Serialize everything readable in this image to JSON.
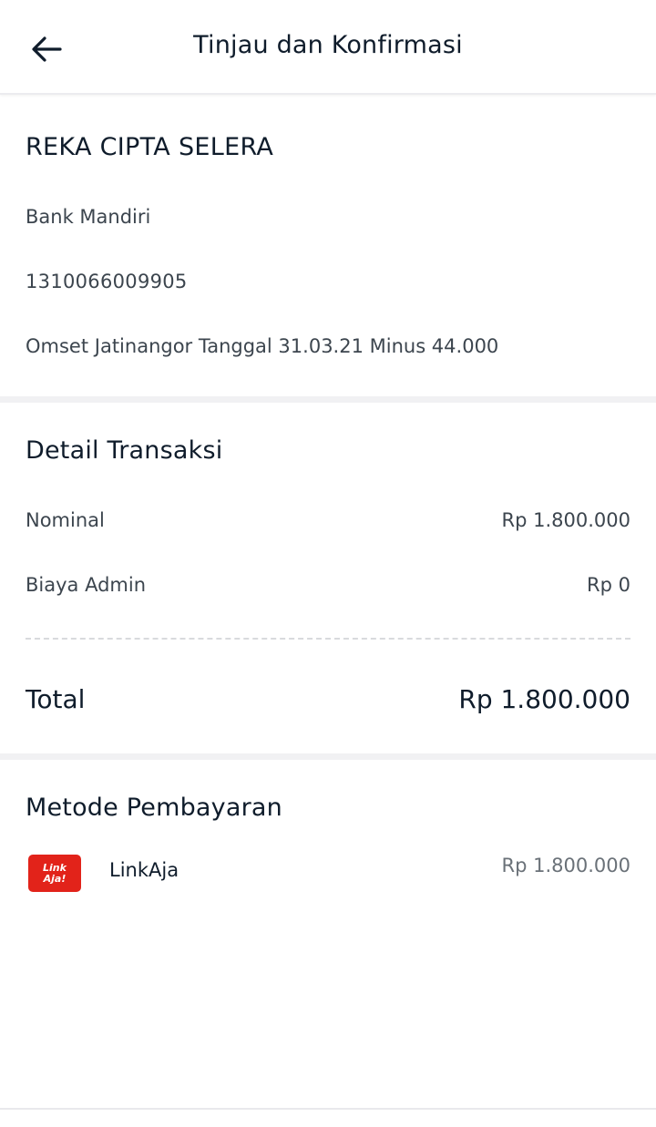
{
  "header": {
    "title": "Tinjau dan Konfirmasi",
    "back_icon": "arrow-left-icon"
  },
  "recipient": {
    "name": "REKA CIPTA SELERA",
    "bank": "Bank Mandiri",
    "account_number": "1310066009905",
    "note": "Omset Jatinangor Tanggal 31.03.21 Minus 44.000"
  },
  "transaction": {
    "title": "Detail Transaksi",
    "nominal_label": "Nominal",
    "nominal_value": "Rp 1.800.000",
    "admin_label": "Biaya Admin",
    "admin_value": "Rp 0",
    "total_label": "Total",
    "total_value": "Rp 1.800.000"
  },
  "payment": {
    "title": "Metode Pembayaran",
    "method_logo_line1": "Link",
    "method_logo_line2": "Aja!",
    "method_name": "LinkAja",
    "method_amount": "Rp 1.800.000"
  },
  "colors": {
    "brand_red": "#e2231a",
    "text_dark": "#0f1c2b",
    "text_body": "#3c454e",
    "separator": "#f1f1f3"
  }
}
